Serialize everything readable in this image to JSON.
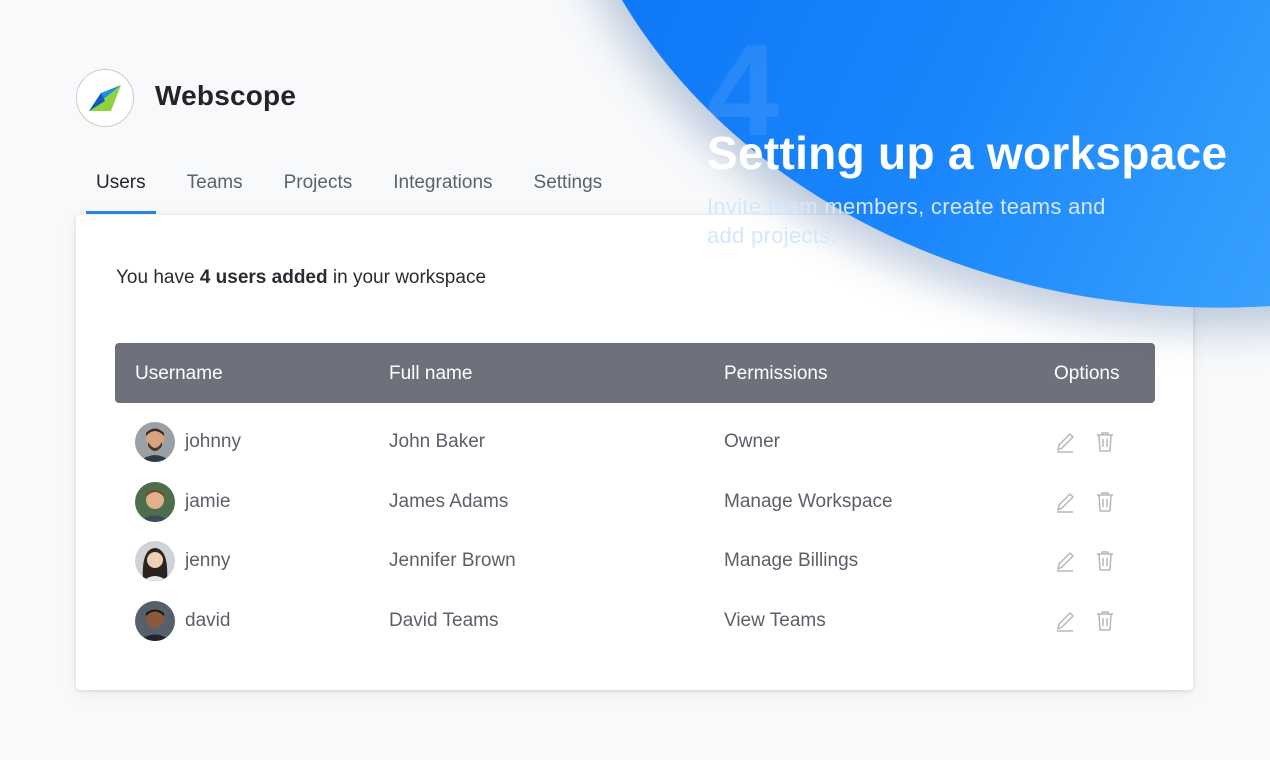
{
  "brand": {
    "name": "Webscope",
    "logo_icon": "webscope-logo-icon"
  },
  "tabs": [
    {
      "label": "Users",
      "active": true
    },
    {
      "label": "Teams",
      "active": false
    },
    {
      "label": "Projects",
      "active": false
    },
    {
      "label": "Integrations",
      "active": false
    },
    {
      "label": "Settings",
      "active": false
    }
  ],
  "summary": {
    "prefix": "You have ",
    "highlight": "4 users added",
    "suffix": " in your workspace"
  },
  "table": {
    "headers": [
      "Username",
      "Full name",
      "Permissions",
      "Options"
    ],
    "rows": [
      {
        "username": "johnny",
        "full_name": "John Baker",
        "permission": "Owner"
      },
      {
        "username": "jamie",
        "full_name": "James Adams",
        "permission": "Manage Workspace"
      },
      {
        "username": "jenny",
        "full_name": "Jennifer Brown",
        "permission": "Manage Billings"
      },
      {
        "username": "david",
        "full_name": "David Teams",
        "permission": "View Teams"
      }
    ],
    "row_actions": [
      "edit-icon",
      "trash-icon"
    ]
  },
  "promo": {
    "number": "4",
    "title": "Setting up a workspace",
    "subtitle": "Invite team members, create teams and add projects."
  },
  "colors": {
    "accent": "#2a86e6",
    "header_bg": "#6e707b",
    "promo_start": "#0a72f5",
    "promo_end": "#55b5ff"
  }
}
